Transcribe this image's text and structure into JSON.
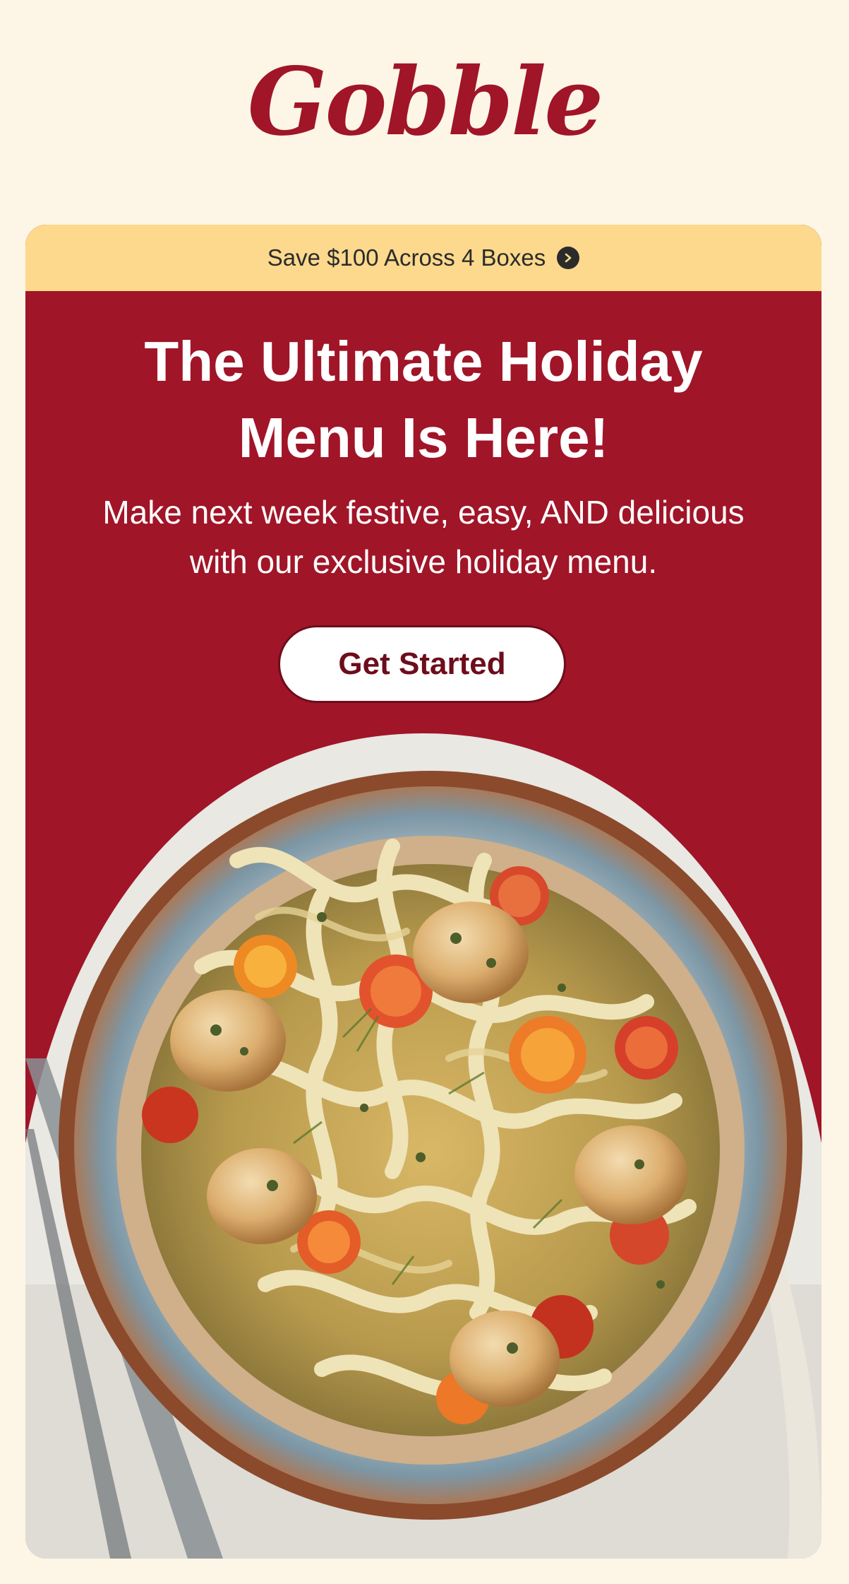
{
  "brand": {
    "logo_text": "Gobble",
    "color": "#a01528"
  },
  "promo_bar": {
    "text": "Save $100 Across 4 Boxes",
    "icon": "chevron-right-circle-icon",
    "background": "#fdd98d"
  },
  "hero": {
    "title_line1": "The Ultimate Holiday",
    "title_line2": "Menu Is Here!",
    "subtitle_line1": "Make next week festive, easy, AND delicious",
    "subtitle_line2": "with our exclusive holiday menu.",
    "cta_label": "Get Started",
    "background": "#a01528"
  },
  "image": {
    "subject": "bowl of scallop fettuccine with cherry tomatoes and dill",
    "icon": "food-bowl-photo"
  }
}
